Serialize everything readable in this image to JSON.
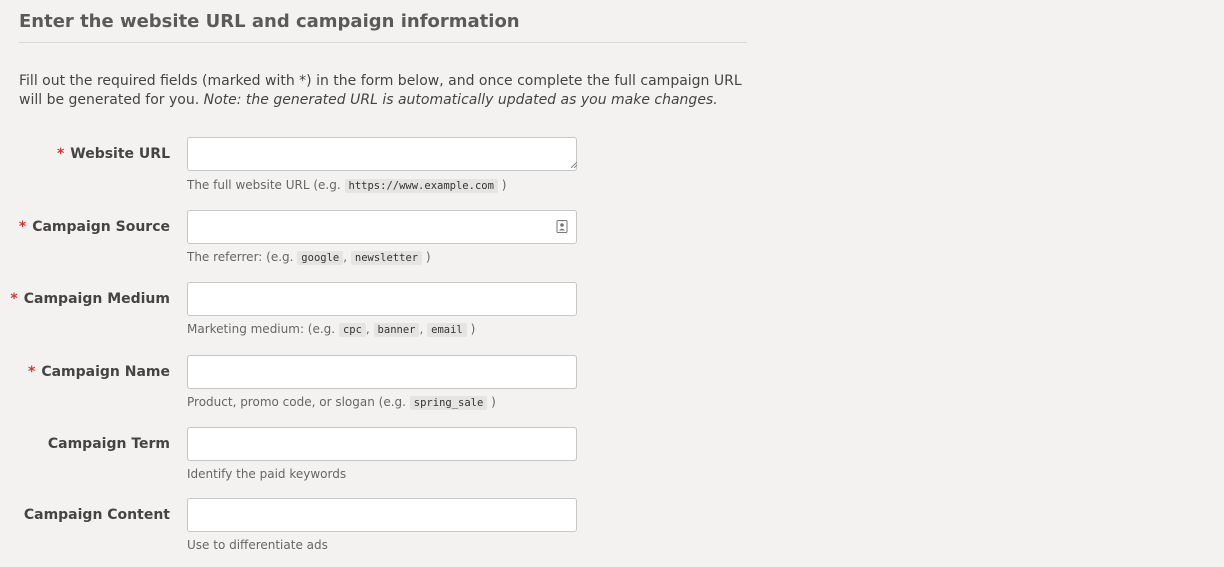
{
  "section": {
    "title": "Enter the website URL and campaign information"
  },
  "intro": {
    "text": "Fill out the required fields (marked with *) in the form below, and once complete the full campaign URL will be generated for you.",
    "note": "Note: the generated URL is automatically updated as you make changes."
  },
  "required_marker": "*",
  "fields": {
    "website_url": {
      "label": "Website URL",
      "value": "",
      "help_prefix": "The full website URL (e.g.",
      "help_examples": [
        "https://www.example.com"
      ],
      "help_suffix": ")"
    },
    "campaign_source": {
      "label": "Campaign Source",
      "value": "",
      "help_prefix": "The referrer: (e.g.",
      "help_examples": [
        "google",
        "newsletter"
      ],
      "help_suffix": ")"
    },
    "campaign_medium": {
      "label": "Campaign Medium",
      "value": "",
      "help_prefix": "Marketing medium: (e.g.",
      "help_examples": [
        "cpc",
        "banner",
        "email"
      ],
      "help_suffix": ")"
    },
    "campaign_name": {
      "label": "Campaign Name",
      "value": "",
      "help_prefix": "Product, promo code, or slogan (e.g.",
      "help_examples": [
        "spring_sale"
      ],
      "help_suffix": ")"
    },
    "campaign_term": {
      "label": "Campaign Term",
      "value": "",
      "help": "Identify the paid keywords"
    },
    "campaign_content": {
      "label": "Campaign Content",
      "value": "",
      "help": "Use to differentiate ads"
    }
  },
  "icons": {
    "source_field_icon": "contact-card-icon",
    "textarea_grip": "resize-grip-icon"
  },
  "colors": {
    "background": "#f4f2f1",
    "required": "#d9322c",
    "input_border": "#c8c6c4",
    "code_bg": "#e6e4e2"
  }
}
